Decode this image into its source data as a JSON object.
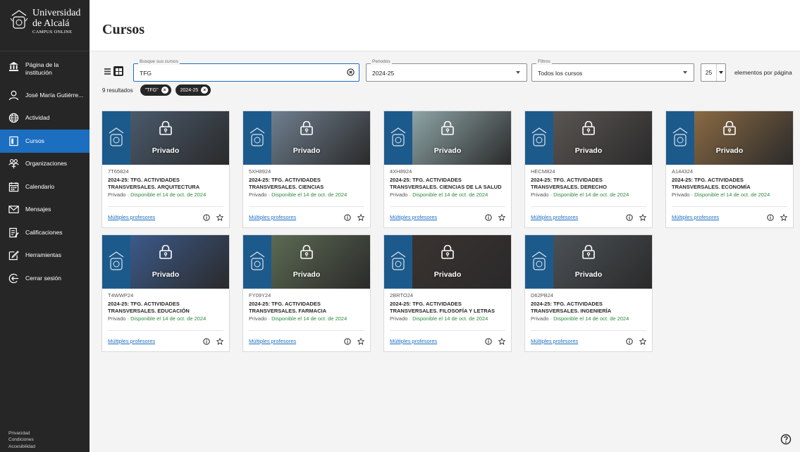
{
  "brand": {
    "line1": "Universidad",
    "line2": "de Alcalá",
    "line3": "CAMPUS ONLINE"
  },
  "sidebar": {
    "items": [
      {
        "label": "Página de la institución",
        "icon": "bank-icon"
      },
      {
        "label": "José María Gutiérre...",
        "icon": "user-icon"
      },
      {
        "label": "Actividad",
        "icon": "globe-icon"
      },
      {
        "label": "Cursos",
        "icon": "book-icon",
        "active": true
      },
      {
        "label": "Organizaciones",
        "icon": "org-icon"
      },
      {
        "label": "Calendario",
        "icon": "calendar-icon"
      },
      {
        "label": "Mensajes",
        "icon": "mail-icon"
      },
      {
        "label": "Calificaciones",
        "icon": "grades-icon"
      },
      {
        "label": "Herramientas",
        "icon": "tools-icon"
      },
      {
        "label": "Cerrar sesión",
        "icon": "logout-icon"
      }
    ],
    "footer": [
      "Privacidad",
      "Condiciones",
      "Accesibilidad"
    ]
  },
  "page": {
    "title": "Cursos"
  },
  "search": {
    "label": "Busque sus cursos",
    "value": "TFG"
  },
  "periods": {
    "label": "Periodos",
    "value": "2024-25"
  },
  "filters": {
    "label": "Filtros",
    "value": "Todos los cursos"
  },
  "per_page": {
    "value": "25",
    "label": "elementos por página"
  },
  "results": {
    "count": "9 resultados",
    "chips": [
      "\"TFG\"",
      "2024-25"
    ]
  },
  "card_common": {
    "privado_overlay": "Privado",
    "status": "Privado",
    "availability": "· Disponible el 14 de oct. de 2024",
    "professors": "Múltiples profesores"
  },
  "courses": [
    {
      "code": "7T65824",
      "title": "2024-25: TFG. ACTIVIDADES TRANSVERSALES. ARQUITECTURA",
      "photo": "#4a5a6c"
    },
    {
      "code": "5XH8924",
      "title": "2024-25: TFG. ACTIVIDADES TRANSVERSALES. CIENCIAS",
      "photo": "#6f7f8f"
    },
    {
      "code": "4XH8924",
      "title": "2024-25: TFG. ACTIVIDADES TRANSVERSALES. CIENCIAS DE LA SALUD",
      "photo": "#8ea4a6"
    },
    {
      "code": "HECM824",
      "title": "2024-25: TFG. ACTIVIDADES TRANSVERSALES. DERECHO",
      "photo": "#5a5552"
    },
    {
      "code": "A144324",
      "title": "2024-25: TFG. ACTIVIDADES TRANSVERSALES. ECONOMÍA",
      "photo": "#8a6a43"
    },
    {
      "code": "T4WWP24",
      "title": "2024-25: TFG. ACTIVIDADES TRANSVERSALES. EDUCACIÓN",
      "photo": "#3c5a8a"
    },
    {
      "code": "FY09Y24",
      "title": "2024-25: TFG. ACTIVIDADES TRANSVERSALES. FARMACIA",
      "photo": "#5c6a52"
    },
    {
      "code": "2BRTO24",
      "title": "2024-25: TFG. ACTIVIDADES TRANSVERSALES. FILOSOFÍA Y LETRAS",
      "photo": "#3a3330"
    },
    {
      "code": "D62PB24",
      "title": "2024-25: TFG. ACTIVIDADES TRANSVERSALES. INGENIERÍA",
      "photo": "#4b5156"
    }
  ],
  "colors": {
    "sidebar_bg": "#262626",
    "active_nav": "#1b6ec0",
    "link": "#1b6ec0",
    "available": "#2b8a3e",
    "crest_blue": "#1d5a8c"
  }
}
